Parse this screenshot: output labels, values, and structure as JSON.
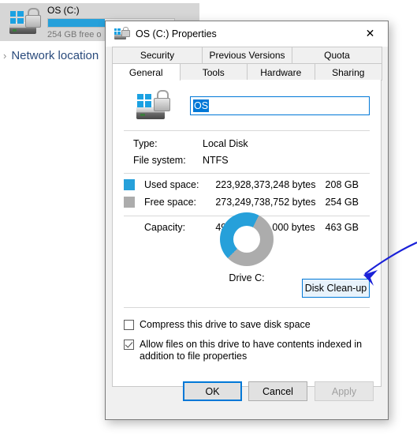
{
  "explorer": {
    "drive_tile": {
      "name": "OS (C:)",
      "free_text": "254 GB free o",
      "icon": "bitlocker-drive-icon",
      "used_percent": 45
    },
    "group_header": {
      "label": "Network location",
      "chevron": "›"
    }
  },
  "dialog": {
    "title": "OS (C:) Properties",
    "title_icon": "bitlocker-drive-icon",
    "close_label": "✕",
    "tabs_row1": [
      {
        "label": "Security",
        "active": false
      },
      {
        "label": "Previous Versions",
        "active": false
      },
      {
        "label": "Quota",
        "active": false
      }
    ],
    "tabs_row2": [
      {
        "label": "General",
        "active": true
      },
      {
        "label": "Tools",
        "active": false
      },
      {
        "label": "Hardware",
        "active": false
      },
      {
        "label": "Sharing",
        "active": false
      }
    ],
    "volume": {
      "icon": "bitlocker-drive-icon",
      "name_value": "OS"
    },
    "info": [
      {
        "key": "Type:",
        "value": "Local Disk"
      },
      {
        "key": "File system:",
        "value": "NTFS"
      }
    ],
    "space": {
      "used": {
        "label": "Used space:",
        "bytes": "223,928,373,248 bytes",
        "gb": "208 GB",
        "color": "#26a0da"
      },
      "free": {
        "label": "Free space:",
        "bytes": "273,249,738,752 bytes",
        "gb": "254 GB",
        "color": "#acacac"
      },
      "capacity": {
        "label": "Capacity:",
        "bytes": "497,178,112,000 bytes",
        "gb": "463 GB"
      }
    },
    "drive_caption": "Drive C:",
    "cleanup_button": "Disk Clean-up",
    "checkboxes": [
      {
        "label": "Compress this drive to save disk space",
        "checked": false
      },
      {
        "label": "Allow files on this drive to have contents indexed in addition to file properties",
        "checked": true
      }
    ],
    "buttons": {
      "ok": "OK",
      "cancel": "Cancel",
      "apply": "Apply"
    }
  },
  "annotation": {
    "type": "arrow",
    "color": "#1a21d8",
    "points_at": "Disk Clean-up"
  },
  "chart_data": {
    "type": "pie",
    "title": "Drive C:",
    "categories": [
      "Used space",
      "Free space"
    ],
    "values": [
      223928373248,
      273249738752
    ],
    "percentages": [
      45.04,
      54.96
    ],
    "labels": [
      "208 GB",
      "254 GB"
    ],
    "colors": [
      "#26a0da",
      "#acacac"
    ],
    "total": 497178112000,
    "units": "bytes",
    "donut": true,
    "legend": "left-list"
  }
}
